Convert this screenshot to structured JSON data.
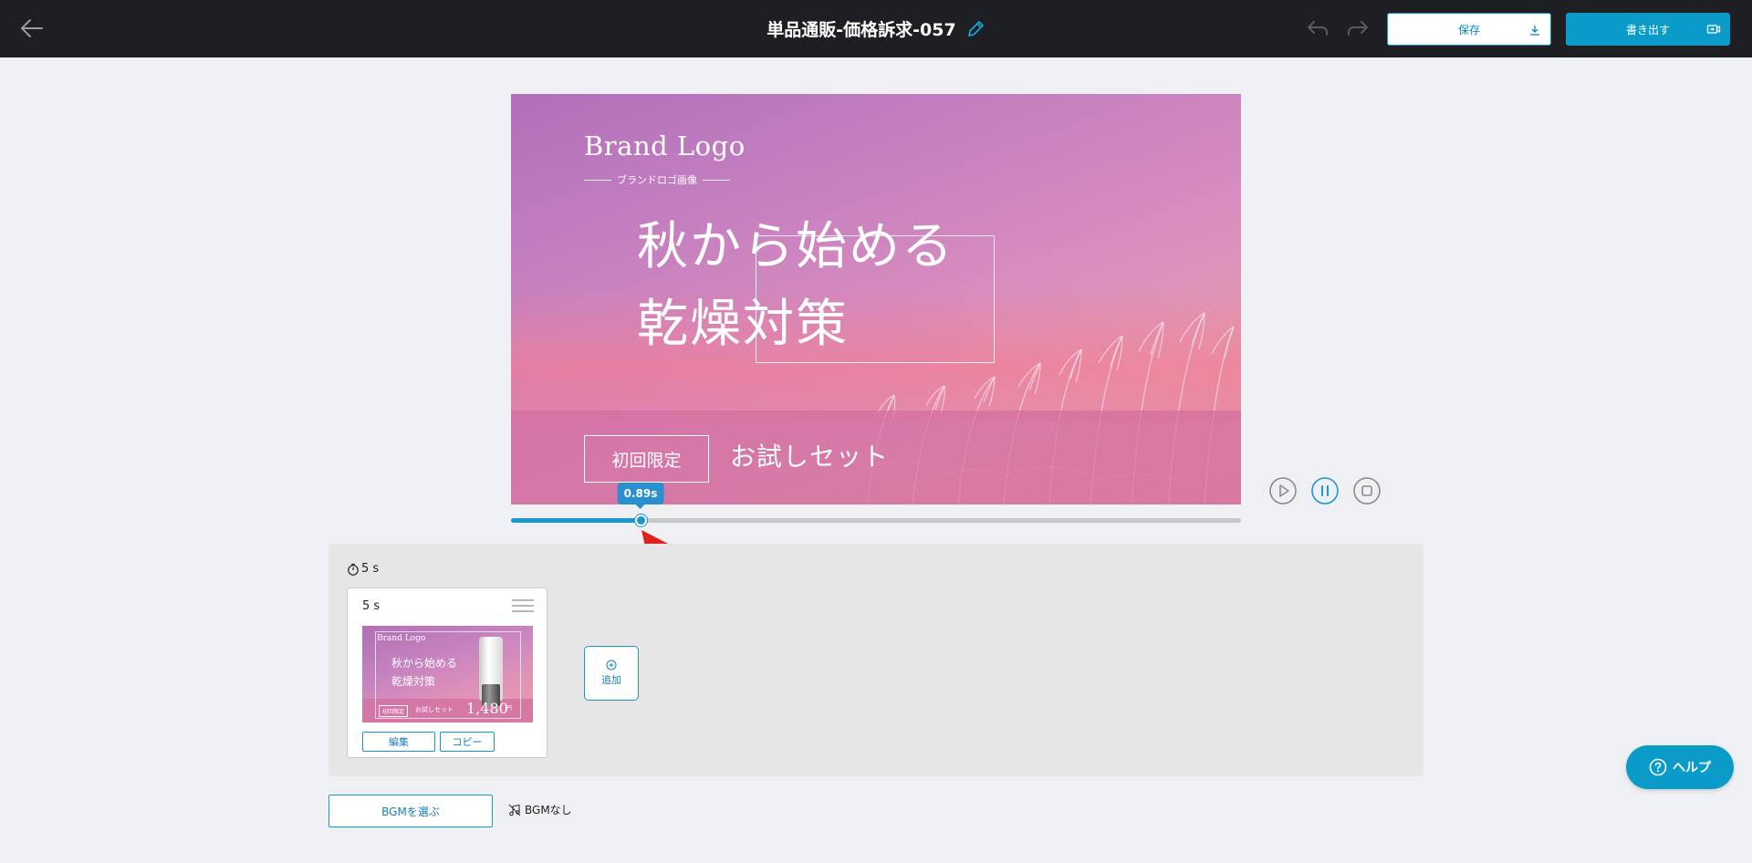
{
  "header": {
    "title": "単品通販-価格訴求-057",
    "save_label": "保存",
    "export_label": "書き出す"
  },
  "preview": {
    "brand_logo": "Brand Logo",
    "brand_sub": "ブランドロゴ画像",
    "headline_line1": "秋から始める",
    "headline_line2": "乾燥対策",
    "badge": "初回限定",
    "trial_set": "お試しセット"
  },
  "playback": {
    "current_time_label": "0.89s",
    "progress_fraction": 0.178
  },
  "timeline": {
    "total_duration": "5 s",
    "scenes": [
      {
        "duration": "5 s",
        "thumbnail": {
          "logo": "Brand Logo",
          "line1": "秋から始める",
          "line2": "乾燥対策",
          "badge": "初回限定",
          "trial": "お試しセット",
          "price": "1,480",
          "yen": "円"
        },
        "edit_label": "編集",
        "copy_label": "コピー"
      }
    ],
    "add_label": "追加"
  },
  "bgm": {
    "choose_label": "BGMを選ぶ",
    "status": "BGMなし"
  },
  "help": {
    "label": "ヘルプ"
  },
  "colors": {
    "accent": "#0a9bc8",
    "header_bg": "#1e1f22",
    "page_bg": "#eef0f3"
  }
}
